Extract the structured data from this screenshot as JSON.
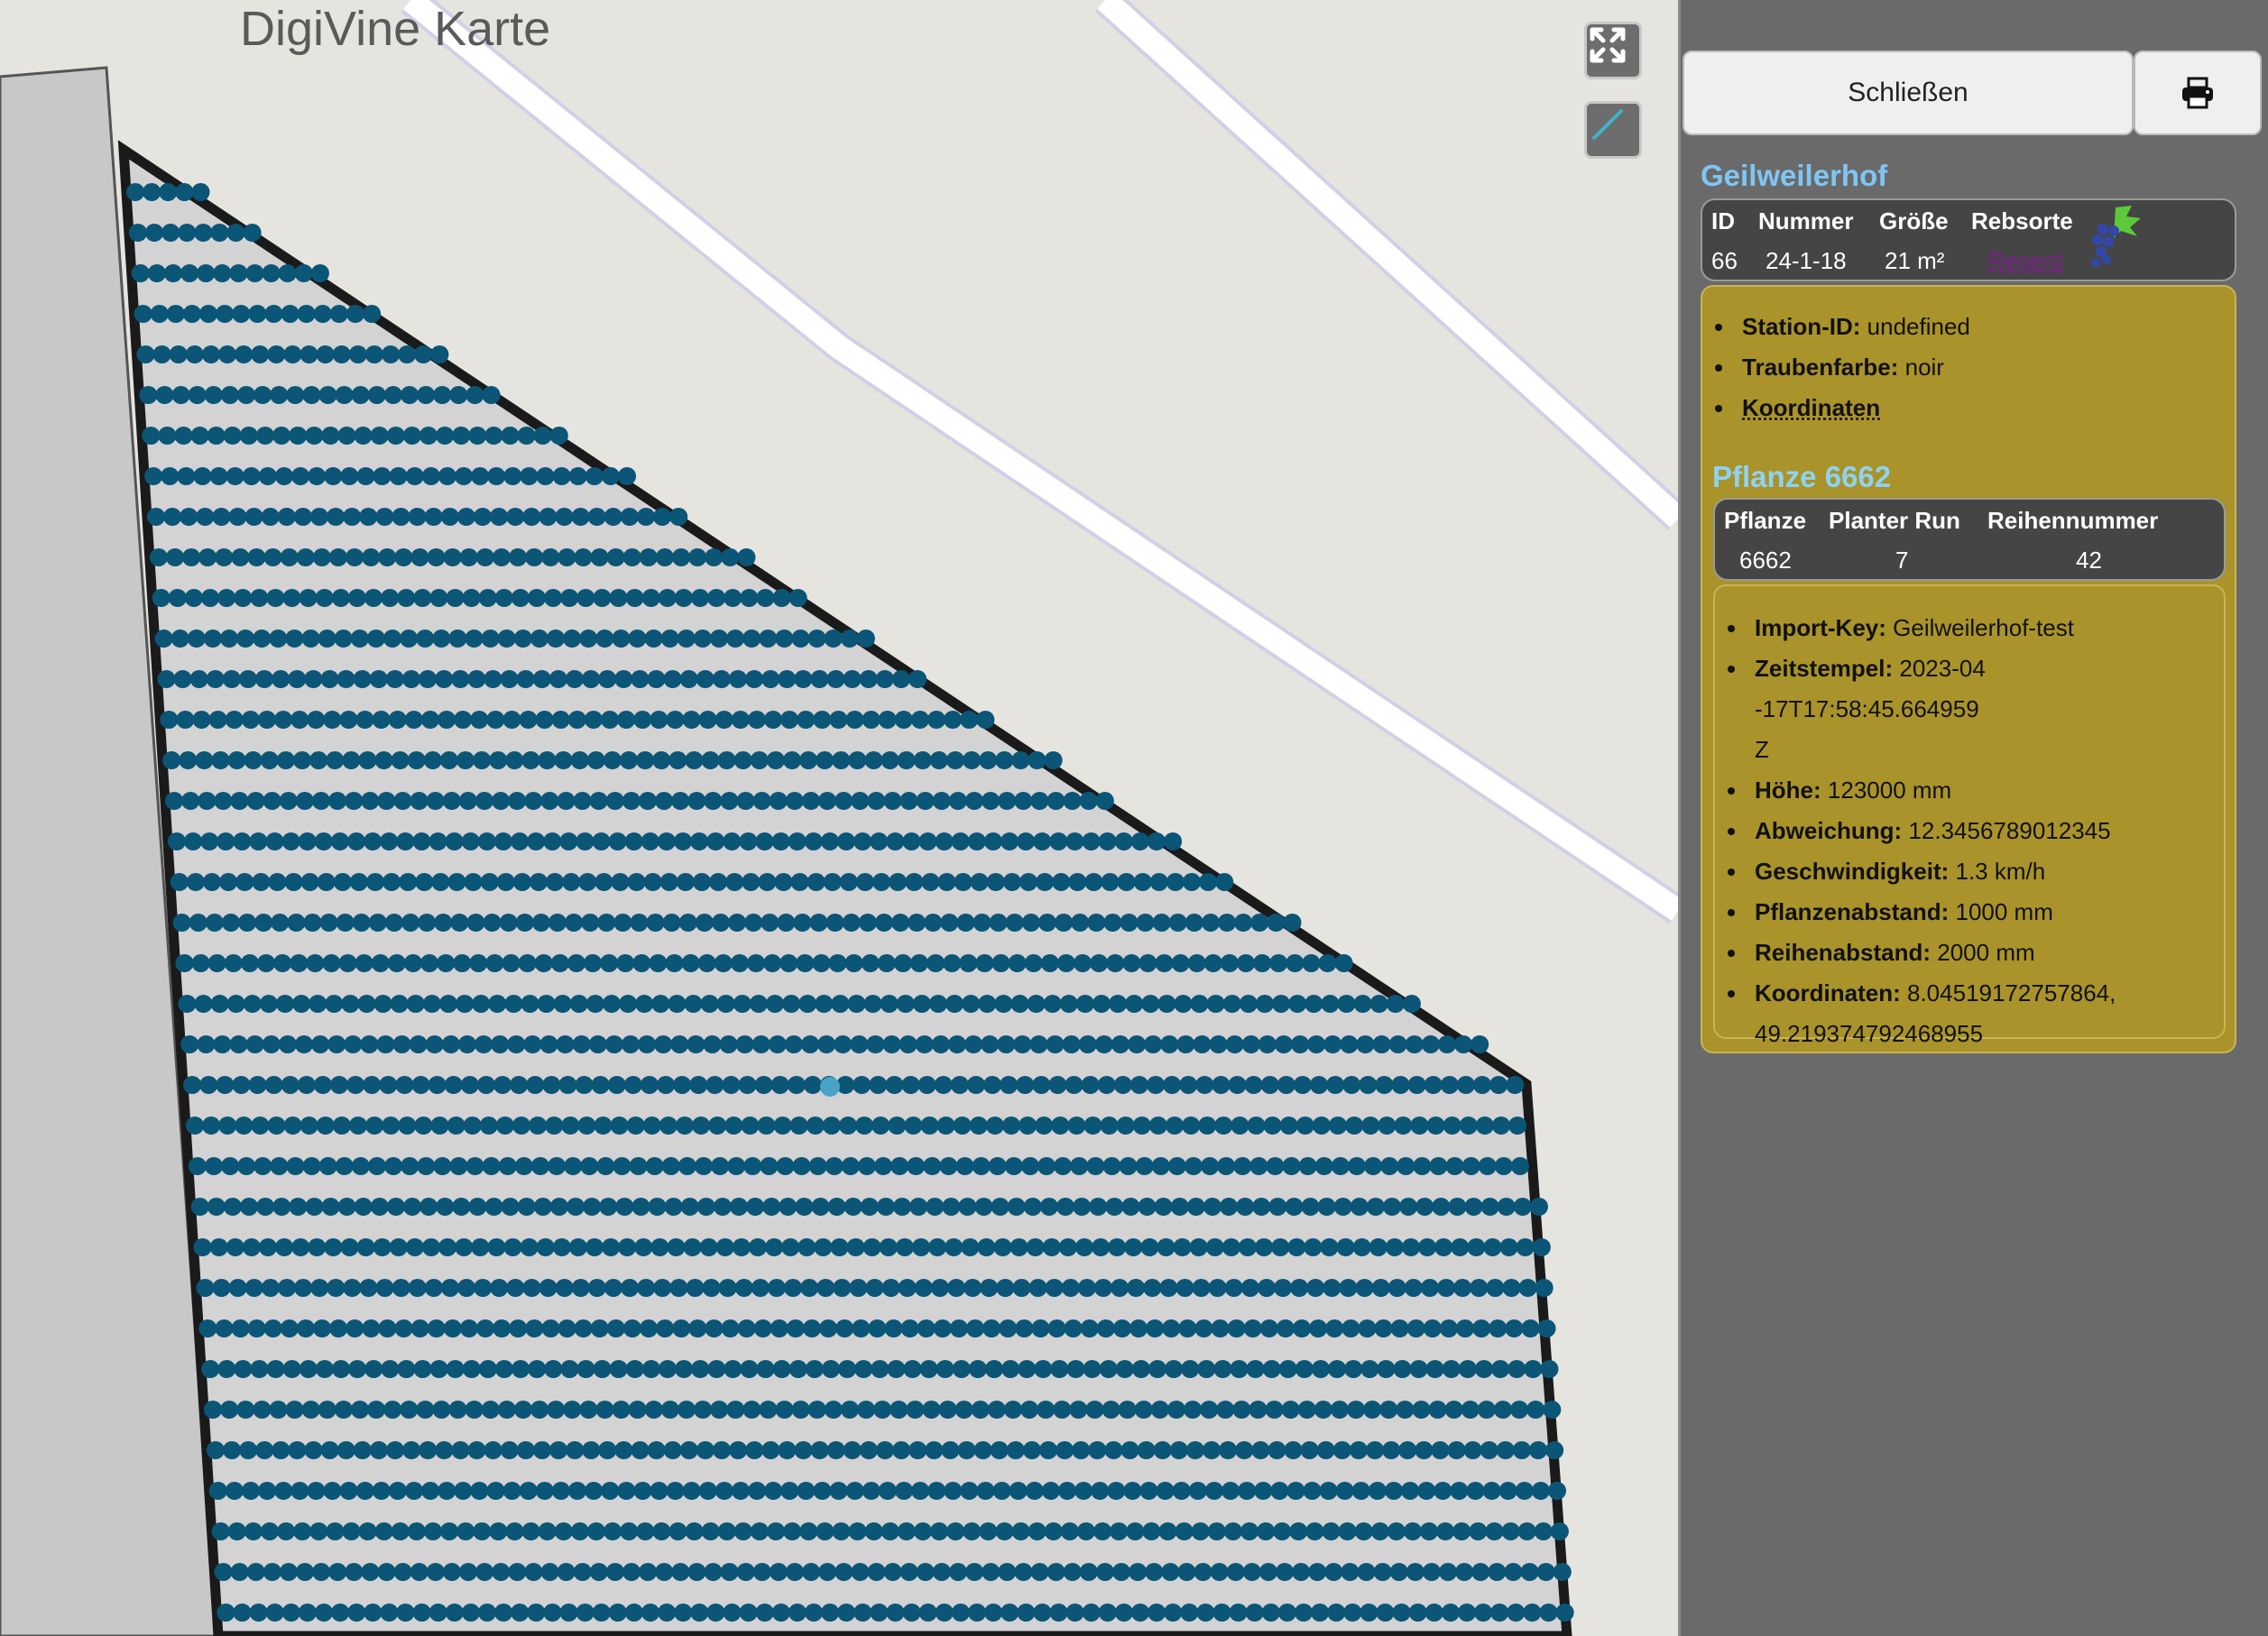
{
  "map": {
    "title": "DigiVine Karte",
    "fullscreen_icon": "expand-arrows-icon",
    "draw_icon": "draw-line-icon"
  },
  "panel": {
    "close_label": "Schließen",
    "print_icon": "printer-icon",
    "site": {
      "title": "Geilweilerhof",
      "headers": [
        "ID",
        "Nummer",
        "Größe",
        "Rebsorte"
      ],
      "values": [
        "66",
        "24-1-18",
        "21 m²",
        "Regent"
      ],
      "grape_icon": "grape-icon",
      "details": [
        {
          "label": "Station-ID:",
          "value": "undefined"
        },
        {
          "label": "Traubenfarbe:",
          "value": "noir"
        },
        {
          "label": "Koordinaten",
          "value": ""
        }
      ]
    },
    "plant": {
      "title": "Pflanze 6662",
      "headers": [
        "Pflanze",
        "Planter Run",
        "Reihennummer"
      ],
      "values": [
        "6662",
        "7",
        "42"
      ],
      "details": [
        {
          "label": "Import-Key:",
          "value": "Geilweilerhof-test"
        },
        {
          "label": "Zeitstempel:",
          "value": "2023-04-17T17:58:45.664959Z"
        },
        {
          "label": "Höhe:",
          "value": "123000 mm"
        },
        {
          "label": "Abweichung:",
          "value": "12.3456789012345"
        },
        {
          "label": "Geschwindigkeit:",
          "value": "1.3 km/h"
        },
        {
          "label": "Pflanzenabstand:",
          "value": "1000 mm"
        },
        {
          "label": "Reihenabstand:",
          "value": "2000 mm"
        },
        {
          "label": "Koordinaten:",
          "value": "8.04519172757864, 49.219374792468955"
        }
      ]
    }
  },
  "colors": {
    "site_title": "#7fc6f5",
    "plant_title": "#8fd2ef",
    "row_dot": "#0b5577",
    "selected_dot": "#4aa3c6",
    "info_box": "#a9932a"
  }
}
